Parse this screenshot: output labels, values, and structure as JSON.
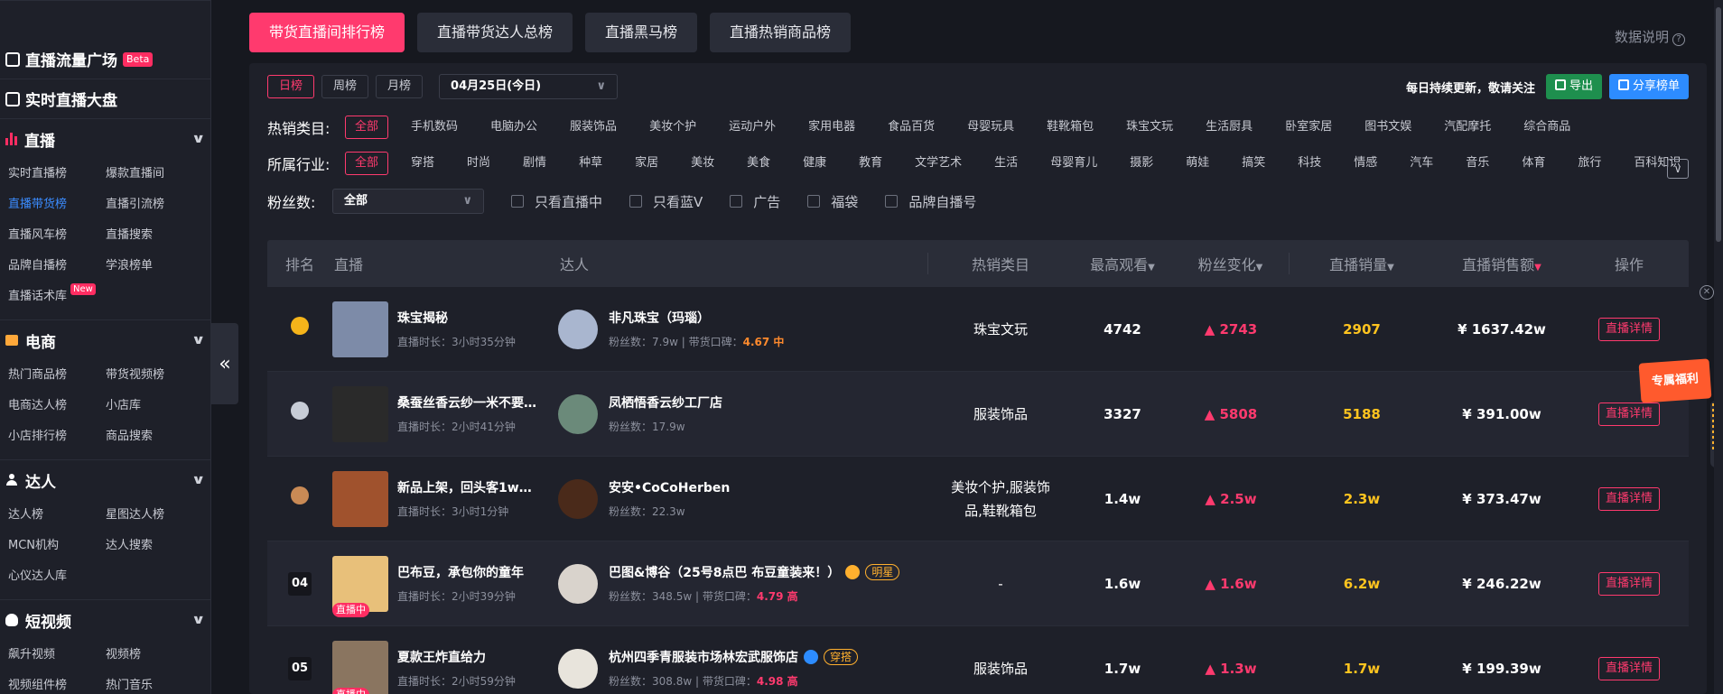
{
  "sidebar": {
    "links": [
      {
        "label": "直播流量广场",
        "badge": "Beta"
      },
      {
        "label": "实时直播大盘"
      }
    ],
    "sections": [
      {
        "title": "直播",
        "items": [
          {
            "label": "实时直播榜"
          },
          {
            "label": "爆款直播间"
          },
          {
            "label": "直播带货榜",
            "active": true
          },
          {
            "label": "直播引流榜"
          },
          {
            "label": "直播风车榜"
          },
          {
            "label": "直播搜索"
          },
          {
            "label": "品牌自播榜"
          },
          {
            "label": "学浪榜单"
          },
          {
            "label": "直播话术库",
            "badge": "New"
          }
        ]
      },
      {
        "title": "电商",
        "items": [
          {
            "label": "热门商品榜"
          },
          {
            "label": "带货视频榜"
          },
          {
            "label": "电商达人榜"
          },
          {
            "label": "小店库"
          },
          {
            "label": "小店排行榜"
          },
          {
            "label": "商品搜索"
          }
        ]
      },
      {
        "title": "达人",
        "items": [
          {
            "label": "达人榜"
          },
          {
            "label": "星图达人榜"
          },
          {
            "label": "MCN机构"
          },
          {
            "label": "达人搜索"
          },
          {
            "label": "心仪达人库"
          }
        ]
      },
      {
        "title": "短视频",
        "items": [
          {
            "label": "飙升视频"
          },
          {
            "label": "视频榜"
          },
          {
            "label": "视频组件榜"
          },
          {
            "label": "热门音乐"
          }
        ]
      }
    ],
    "collapse_glyph": "«"
  },
  "tabs": [
    {
      "label": "带货直播间排行榜",
      "active": true
    },
    {
      "label": "直播带货达人总榜"
    },
    {
      "label": "直播黑马榜"
    },
    {
      "label": "直播热销商品榜"
    }
  ],
  "data_desc": "数据说明",
  "period": {
    "options": [
      {
        "label": "日榜",
        "active": true
      },
      {
        "label": "周榜"
      },
      {
        "label": "月榜"
      }
    ],
    "date": "04月25日(今日)"
  },
  "toolbar": {
    "update_text": "每日持续更新，敬请关注",
    "export_label": "导出",
    "share_label": "分享榜单"
  },
  "filters": {
    "category": {
      "label": "热销类目:",
      "options": [
        "全部",
        "手机数码",
        "电脑办公",
        "服装饰品",
        "美妆个护",
        "运动户外",
        "家用电器",
        "食品百货",
        "母婴玩具",
        "鞋靴箱包",
        "珠宝文玩",
        "生活厨具",
        "卧室家居",
        "图书文娱",
        "汽配摩托",
        "综合商品"
      ]
    },
    "industry": {
      "label": "所属行业:",
      "options": [
        "全部",
        "穿搭",
        "时尚",
        "剧情",
        "种草",
        "家居",
        "美妆",
        "美食",
        "健康",
        "教育",
        "文学艺术",
        "生活",
        "母婴育儿",
        "摄影",
        "萌娃",
        "搞笑",
        "科技",
        "情感",
        "汽车",
        "音乐",
        "体育",
        "旅行",
        "百科知识"
      ]
    },
    "fans": {
      "label": "粉丝数:",
      "selected": "全部",
      "checks": [
        "只看直播中",
        "只看蓝V",
        "广告",
        "福袋",
        "品牌自播号"
      ]
    }
  },
  "table": {
    "headers": {
      "rank": "排名",
      "live": "直播",
      "talent": "达人",
      "category": "热销类目",
      "max_view": "最高观看",
      "fans_change": "粉丝变化",
      "sales": "直播销量",
      "amount": "直播销售额",
      "op": "操作"
    },
    "detail_label": "直播详情",
    "rows": [
      {
        "rank": "1",
        "medal": "gold",
        "title": "珠宝揭秘",
        "duration": "直播时长：3小时35分钟",
        "talent": "非凡珠宝（玛瑙）",
        "fans": "粉丝数：7.9w",
        "rep_label": "带货口碑：",
        "rep": "4.67 中",
        "rep_color": "orange",
        "category": "珠宝文玩",
        "max_view": "4742",
        "fans_change": "▲ 2743",
        "sales": "2907",
        "amount": "¥ 1637.42w",
        "thumb_color": "#7d8ba8",
        "avatar_color": "#a9b6cf"
      },
      {
        "rank": "2",
        "medal": "silver",
        "title": "桑蚕丝香云纱一米不要…",
        "duration": "直播时长：2小时41分钟",
        "talent": "凤栖悟香云纱工厂店",
        "fans": "粉丝数：17.9w",
        "category": "服装饰品",
        "max_view": "3327",
        "fans_change": "▲ 5808",
        "sales": "5188",
        "amount": "¥ 391.00w",
        "thumb_color": "#2a2a2a",
        "avatar_color": "#6b8a7a"
      },
      {
        "rank": "3",
        "medal": "bronze",
        "title": "新品上架，回头客1w正…",
        "duration": "直播时长：3小时1分钟",
        "talent": "安安•CoCoHerben",
        "fans": "粉丝数：22.3w",
        "category": "美妆个护,服装饰品,鞋靴箱包",
        "max_view": "1.4w",
        "fans_change": "▲ 2.5w",
        "sales": "2.3w",
        "amount": "¥ 373.47w",
        "thumb_color": "#a0522d",
        "avatar_color": "#4a2a1a"
      },
      {
        "rank": "04",
        "title": "巴布豆，承包你的童年",
        "duration": "直播时长：2小时39分钟",
        "live_badge": "直播中",
        "talent": "巴图&博谷（25号8点巴 布豆童装来！）",
        "verified": true,
        "tag": "明星",
        "fans": "粉丝数：348.5w",
        "rep_label": "带货口碑：",
        "rep": "4.79 高",
        "rep_color": "red",
        "category": "-",
        "max_view": "1.6w",
        "fans_change": "▲ 1.6w",
        "sales": "6.2w",
        "amount": "¥ 246.22w",
        "thumb_color": "#e8c07a",
        "avatar_color": "#d9d3cc"
      },
      {
        "rank": "05",
        "title": "夏款王炸直给力",
        "duration": "直播时长：2小时59分钟",
        "live_badge": "直播中",
        "talent": "杭州四季青服装市场林宏武服饰店",
        "verified": true,
        "verify_color": "#2d8cff",
        "tag": "穿搭",
        "fans": "粉丝数：308.8w",
        "rep_label": "带货口碑：",
        "rep": "4.98 高",
        "rep_color": "red",
        "category": "服装饰品",
        "max_view": "1.7w",
        "fans_change": "▲ 1.3w",
        "sales": "1.7w",
        "amount": "¥ 199.39w",
        "thumb_color": "#8a7560",
        "avatar_color": "#e8e4dc"
      }
    ]
  },
  "promo": "专属福利",
  "colors": {
    "accent": "#ff3a6e",
    "gold": "#ffc41f",
    "bg": "#16181f",
    "panel": "#1e2029"
  }
}
